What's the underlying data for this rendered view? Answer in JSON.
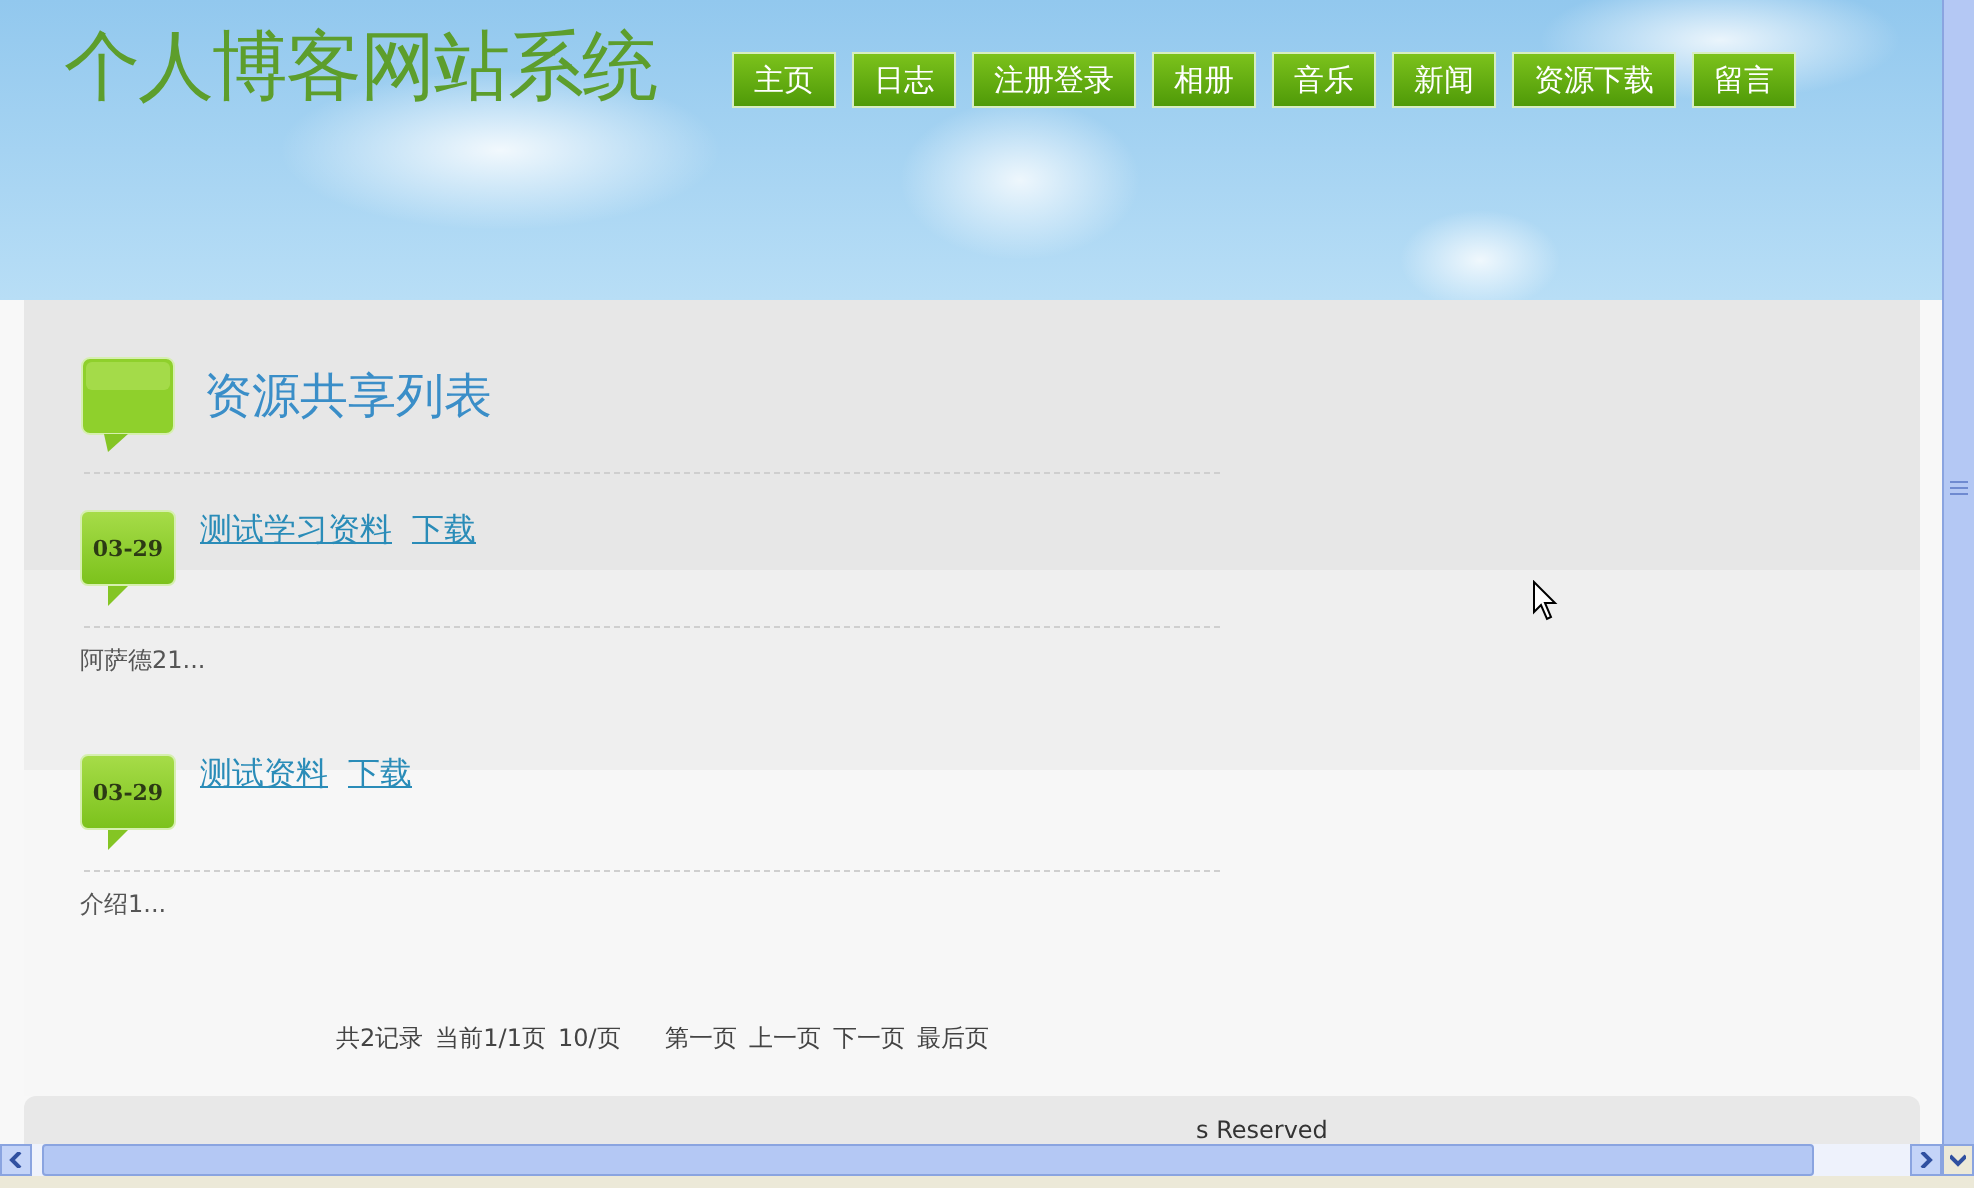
{
  "site_title": "个人博客网站系统",
  "nav": [
    {
      "label": "主页"
    },
    {
      "label": "日志"
    },
    {
      "label": "注册登录"
    },
    {
      "label": "相册"
    },
    {
      "label": "音乐"
    },
    {
      "label": "新闻"
    },
    {
      "label": "资源下载"
    },
    {
      "label": "留言"
    }
  ],
  "page_heading": "资源共享列表",
  "resources": [
    {
      "date": "03-29",
      "title": "测试学习资料",
      "link": "下载",
      "summary": "阿萨德21..."
    },
    {
      "date": "03-29",
      "title": "测试资料",
      "link": "下载",
      "summary": "介绍1..."
    }
  ],
  "pagination": {
    "info": [
      "共2记录",
      "当前1/1页",
      "10/页"
    ],
    "links": [
      "第一页",
      "上一页",
      "下一页",
      "最后页"
    ]
  },
  "footer": "s Reserved"
}
